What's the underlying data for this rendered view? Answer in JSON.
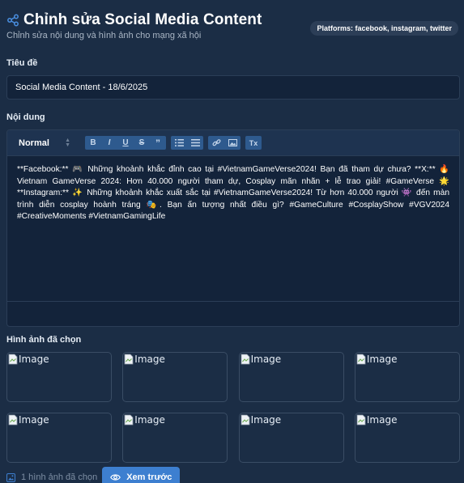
{
  "header": {
    "title": "Chỉnh sửa Social Media Content",
    "subtitle": "Chỉnh sửa nội dung và hình ảnh cho mạng xã hội",
    "platforms": "Platforms: facebook, instagram, twitter",
    "icon": "share-icon"
  },
  "title_field": {
    "label": "Tiêu đề",
    "value": "Social Media Content - 18/6/2025"
  },
  "content_field": {
    "label": "Nội dung",
    "toolbar": {
      "format": "Normal",
      "buttons": [
        "B",
        "I",
        "U",
        "S",
        "”",
        "☰",
        "≡",
        "🔗",
        "🖼",
        "Tx"
      ]
    },
    "text": "**Facebook:** 🎮 Những khoảnh khắc đỉnh cao tại #VietnamGameVerse2024! Bạn đã tham dự chưa? **X:** 🔥 Vietnam GameVerse 2024: Hơn 40.000 người tham dự, Cosplay mãn nhãn + lễ trao giải! #GameVerse 🌟 **Instagram:** ✨ Những khoảnh khắc xuất sắc tại #VietnamGameVerse2024! Từ hơn 40.000 người 👾 đến màn trình diễn cosplay hoành tráng 🎭. Bạn ấn tượng nhất điều gì? #GameCulture #CosplayShow #VGV2024 #CreativeMoments #VietnamGamingLife"
  },
  "images": {
    "label": "Hình ảnh đã chọn",
    "items": [
      {
        "alt": "Image"
      },
      {
        "alt": "Image"
      },
      {
        "alt": "Image"
      },
      {
        "alt": "Image"
      },
      {
        "alt": "Image"
      },
      {
        "alt": "Image"
      },
      {
        "alt": "Image"
      },
      {
        "alt": "Image"
      }
    ]
  },
  "footer": {
    "count_text": "1 hình ảnh đã chọn",
    "preview_label": "Xem trước"
  },
  "colors": {
    "background": "#1b2d45",
    "accent": "#3d7fd0",
    "input_bg": "#13233a"
  }
}
